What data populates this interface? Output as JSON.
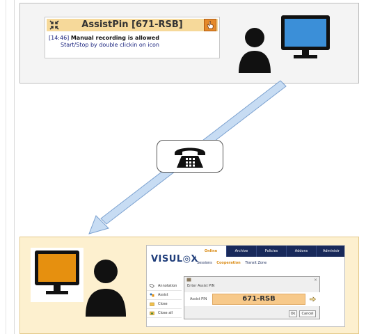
{
  "assistpin_window": {
    "title": "AssistPin [671-RSB]",
    "log_time": "[14:46]",
    "log_message": "Manual recording is allowed",
    "log_hint": "Start/Stop by double clickin on icon"
  },
  "agent_console": {
    "logo": "VISUL◎X",
    "tabs": [
      "Online",
      "Archive",
      "Policies",
      "Addons",
      "Administr"
    ],
    "active_tab": "Online",
    "subtabs": [
      "Sessions",
      "Cooperation",
      "Transit Zone"
    ],
    "active_subtab": "Cooperation",
    "side_menu": [
      "Annotation",
      "Assist",
      "Close",
      "Close all"
    ],
    "dialog": {
      "title": "Enter Assist PIN",
      "pin_label": "Assist PIN",
      "pin_value": "671-RSB",
      "ok_label": "Ok",
      "cancel_label": "Cancel"
    }
  },
  "icons": {
    "top_user": "user-icon",
    "top_monitor": "monitor-icon",
    "phone": "telephone-icon",
    "bottom_monitor": "monitor-icon",
    "bottom_user": "user-icon"
  },
  "colors": {
    "top_panel": "#f4f4f4",
    "bottom_panel": "#fdf0cf",
    "customer_screen": "#3b8fd8",
    "agent_screen": "#e6900f",
    "connector": "#c7dcf3",
    "console_navy": "#18295a",
    "pin_field": "#f7c98a"
  }
}
